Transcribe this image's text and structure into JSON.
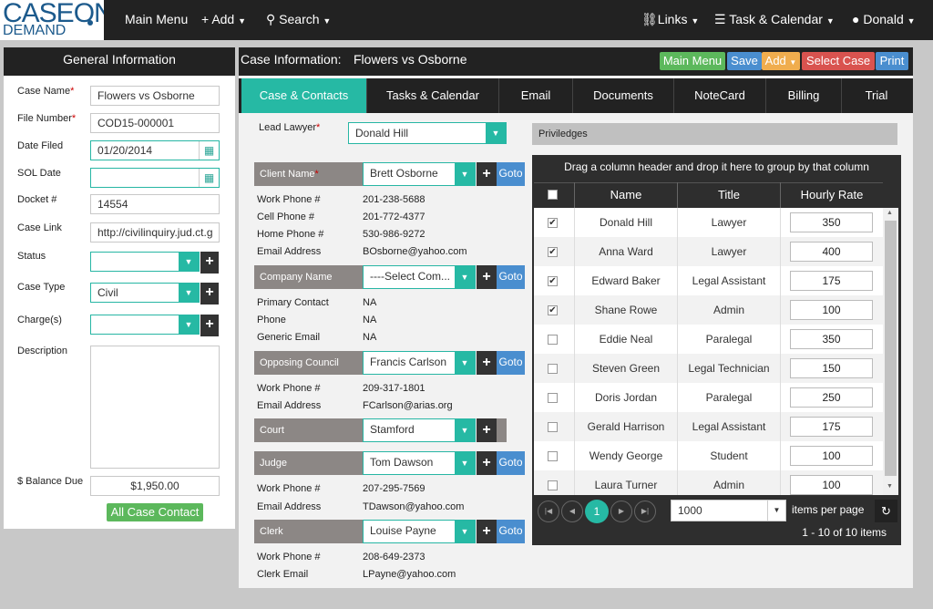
{
  "brand": {
    "line1": "CASE",
    "on": "ON",
    "line2": "DEMAND"
  },
  "nav": {
    "main_menu": "Main Menu",
    "add": "Add",
    "search": "Search",
    "links": "Links",
    "task_calendar": "Task & Calendar",
    "user": "Donald"
  },
  "general": {
    "title": "General Information",
    "case_name_label": "Case Name",
    "case_name": "Flowers vs Osborne",
    "file_number_label": "File Number",
    "file_number": "COD15-000001",
    "date_filed_label": "Date Filed",
    "date_filed": "01/20/2014",
    "sol_date_label": "SOL Date",
    "sol_date": "",
    "docket_label": "Docket #",
    "docket": "14554",
    "case_link_label": "Case Link",
    "case_link": "http://civilinquiry.jud.ct.g",
    "status_label": "Status",
    "status": "",
    "case_type_label": "Case Type",
    "case_type": "Civil",
    "charges_label": "Charge(s)",
    "charges": "",
    "description_label": "Description",
    "balance_label": "$ Balance Due",
    "balance": "$1,950.00",
    "all_contacts_button": "All Case Contact"
  },
  "case_info": {
    "label": "Case Information:",
    "name": "Flowers vs Osborne",
    "buttons": {
      "main_menu": "Main Menu",
      "save": "Save",
      "add": "Add",
      "select_case": "Select Case",
      "print": "Print"
    },
    "button_colors": {
      "main_menu": "#5cb85c",
      "save": "#4a8ecf",
      "add": "#f0ad4e",
      "select_case": "#d9534f",
      "print": "#4a8ecf"
    }
  },
  "tabs": [
    "Case & Contacts",
    "Tasks & Calendar",
    "Email",
    "Documents",
    "NoteCard",
    "Billing",
    "Trial"
  ],
  "contacts": {
    "lead_lawyer_label": "Lead Lawyer",
    "lead_lawyer": "Donald Hill",
    "client": {
      "label": "Client Name",
      "value": "Brett Osborne",
      "goto": "Goto",
      "work_phone_label": "Work Phone #",
      "work_phone": "201-238-5688",
      "cell_phone_label": "Cell Phone #",
      "cell_phone": "201-772-4377",
      "home_phone_label": "Home Phone #",
      "home_phone": "530-986-9272",
      "email_label": "Email Address",
      "email": "BOsborne@yahoo.com"
    },
    "company": {
      "label": "Company Name",
      "value": "----Select Com...",
      "goto": "Goto",
      "primary_label": "Primary Contact",
      "primary": "NA",
      "phone_label": "Phone",
      "phone": "NA",
      "email_label": "Generic Email",
      "email": "NA"
    },
    "opposing": {
      "label": "Opposing Council",
      "value": "Francis Carlson",
      "goto": "Goto",
      "work_phone_label": "Work Phone #",
      "work_phone": "209-317-1801",
      "email_label": "Email Address",
      "email": "FCarlson@arias.org"
    },
    "court": {
      "label": "Court",
      "value": "Stamford"
    },
    "judge": {
      "label": "Judge",
      "value": "Tom Dawson",
      "goto": "Goto",
      "work_phone_label": "Work Phone #",
      "work_phone": "207-295-7569",
      "email_label": "Email Address",
      "email": "TDawson@yahoo.com"
    },
    "clerk": {
      "label": "Clerk",
      "value": "Louise Payne",
      "goto": "Goto",
      "work_phone_label": "Work Phone #",
      "work_phone": "208-649-2373",
      "email_label": "Clerk Email",
      "email": "LPayne@yahoo.com"
    }
  },
  "privileges": {
    "title": "Priviledges",
    "group_hint": "Drag a column header and drop it here to group by that column",
    "columns": [
      "Name",
      "Title",
      "Hourly Rate"
    ],
    "rows": [
      {
        "checked": true,
        "name": "Donald Hill",
        "title": "Lawyer",
        "rate": "350"
      },
      {
        "checked": true,
        "name": "Anna Ward",
        "title": "Lawyer",
        "rate": "400"
      },
      {
        "checked": true,
        "name": "Edward Baker",
        "title": "Legal Assistant",
        "rate": "175"
      },
      {
        "checked": true,
        "name": "Shane Rowe",
        "title": "Admin",
        "rate": "100"
      },
      {
        "checked": false,
        "name": "Eddie Neal",
        "title": "Paralegal",
        "rate": "350"
      },
      {
        "checked": false,
        "name": "Steven Green",
        "title": "Legal Technician",
        "rate": "150"
      },
      {
        "checked": false,
        "name": "Doris Jordan",
        "title": "Paralegal",
        "rate": "250"
      },
      {
        "checked": false,
        "name": "Gerald Harrison",
        "title": "Legal Assistant",
        "rate": "175"
      },
      {
        "checked": false,
        "name": "Wendy George",
        "title": "Student",
        "rate": "100"
      },
      {
        "checked": false,
        "name": "Laura Turner",
        "title": "Admin",
        "rate": "100"
      }
    ],
    "pager": {
      "current_page": "1",
      "page_size": "1000",
      "items_per_page": "items per page",
      "summary": "1 - 10 of 10 items"
    }
  }
}
